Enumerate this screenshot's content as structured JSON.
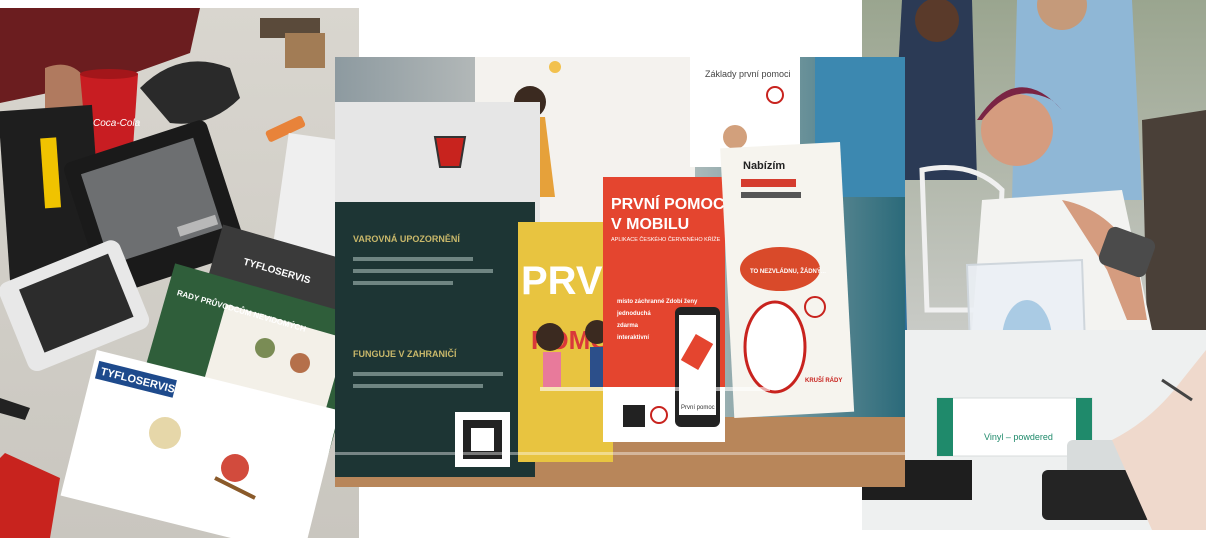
{
  "collage": {
    "left_photo": {
      "cup_brand": "Coca-Cola",
      "booklet_top_title": "TYFLOSERVIS",
      "booklet_green_title": "RADY PRŮVODCŮM NEVIDOMÝCH",
      "booklet_front_brand": "TYFLOSERVIS"
    },
    "center_photo": {
      "dark_card_heading": "VAROVNÁ UPOZORNĚNÍ",
      "dark_card_subheading": "FUNGUJE V ZAHRANIČÍ",
      "sign_top": "Základy první pomoci",
      "yellow_card_text": "PRVN",
      "yellow_card_text2": "POMOC",
      "red_card_title_line1": "PRVNÍ POMOC",
      "red_card_title_line2": "V MOBILU",
      "red_card_subtitle": "APLIKACE ČESKÉHO ČERVENÉHO KŘÍŽE",
      "red_card_bullets": [
        "místo záchranné Zdobí ženy",
        "jednoduchá",
        "zdarma",
        "interaktivní"
      ],
      "phone_label": "První pomoc",
      "right_card_top": "Nabízím",
      "right_card_mid": "TO NEZVLÁDNU, ŽÁDNÝ...",
      "right_card_bottom": "KRUŠÍ RÁDY"
    },
    "right_photo": {
      "glove_box_label": "Vinyl – powdered"
    }
  }
}
